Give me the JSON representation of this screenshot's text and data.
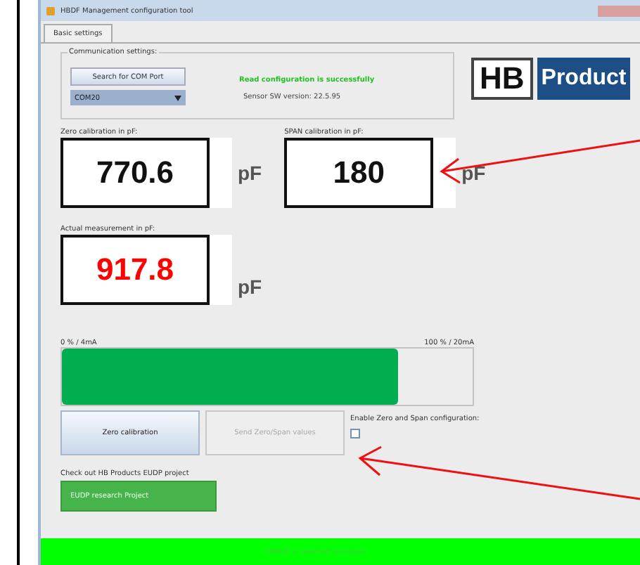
{
  "window": {
    "title": "HBDF Management configuration tool"
  },
  "tabs": [
    {
      "label": "Basic settings",
      "selected": true
    }
  ],
  "communication": {
    "legend": "Communication settings:",
    "search_button": "Search for COM Port",
    "port": "COM20",
    "status": "Read configuration is successfully",
    "version": "Sensor SW version: 22.5.95"
  },
  "logo": {
    "left": "HB",
    "right": "Product"
  },
  "zero": {
    "label": "Zero calibration in pF:",
    "value": "770.6",
    "unit": "pF"
  },
  "span": {
    "label": "SPAN calibration in pF:",
    "value": "180",
    "unit": "pF"
  },
  "actual": {
    "label": "Actual measurement in pF:",
    "value": "917.8",
    "unit": "pF"
  },
  "output": {
    "min_label": "0 % / 4mA",
    "max_label": "100 % / 20mA",
    "level": 0.82
  },
  "buttons": [
    {
      "label": "Zero calibration",
      "disabled": false
    },
    {
      "label": "Send Zero/Span values",
      "disabled": true
    }
  ],
  "enable": {
    "label": "Enable Zero and Span configuration:",
    "checked": false
  },
  "eudp": {
    "label": "Check out HB Products EUDP project",
    "button": "EUDP research Project"
  },
  "status_bar": "COM20 is selected and open"
}
